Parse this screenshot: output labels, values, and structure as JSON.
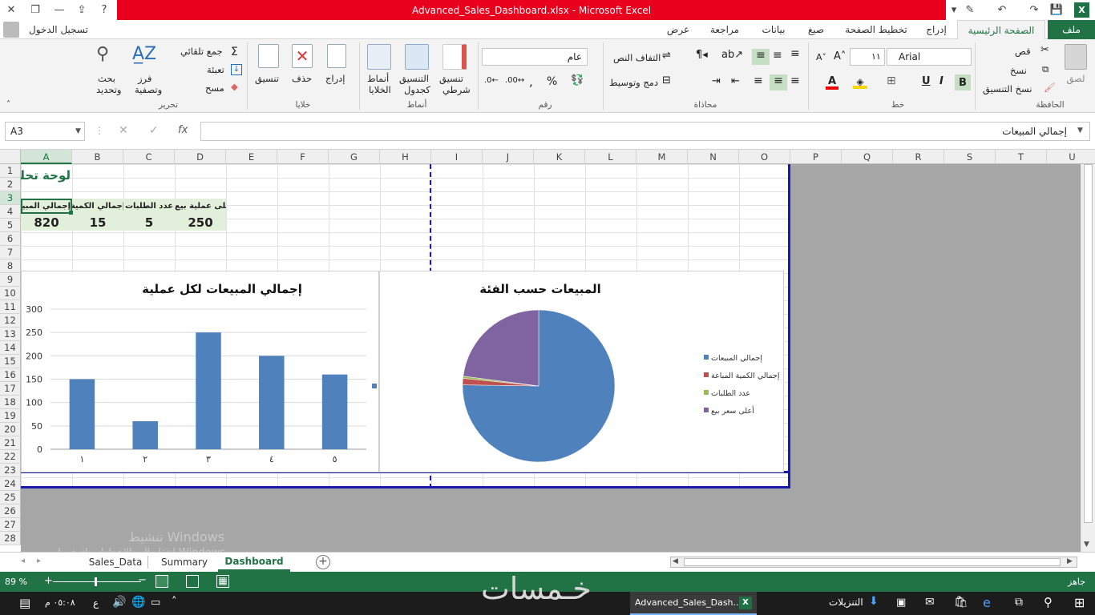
{
  "window": {
    "title": "Advanced_Sales_Dashboard.xlsx -  Microsoft Excel",
    "sign_in": "تسجيل الدخول"
  },
  "tabs": [
    "ملف",
    "الصفحة الرئيسية",
    "إدراج",
    "تخطيط الصفحة",
    "صيغ",
    "بيانات",
    "مراجعة",
    "عرض"
  ],
  "ribbon": {
    "clipboard": {
      "label": "الحافظة",
      "paste": "لصق",
      "cut": "قص",
      "copy": "نسخ",
      "format_painter": "نسخ التنسيق"
    },
    "font": {
      "label": "خط",
      "name": "Arial",
      "size": "١١"
    },
    "alignment": {
      "label": "محاذاة",
      "wrap": "التفاف النص",
      "merge": "دمج وتوسيط"
    },
    "number": {
      "label": "رقم",
      "format": "عام"
    },
    "styles": {
      "label": "أنماط",
      "conditional": "تنسيق",
      "conditional2": "شرطي",
      "table": "التنسيق",
      "table2": "كجدول",
      "cell_styles": "أنماط",
      "cell_styles2": "الخلايا"
    },
    "cells": {
      "label": "خلايا",
      "insert": "إدراج",
      "delete": "حذف",
      "format": "تنسيق"
    },
    "editing": {
      "label": "تحرير",
      "autosum": "جمع تلقائي",
      "fill": "تعبئة",
      "clear": "مسح",
      "sort": "فرز",
      "sort2": "وتصفية",
      "find": "بحث",
      "find2": "وتحديد"
    }
  },
  "formula_bar": {
    "name_box": "A3",
    "fx": "fx",
    "content": "إجمالي المبيعات"
  },
  "columns": [
    "A",
    "B",
    "C",
    "D",
    "E",
    "F",
    "G",
    "H",
    "I",
    "J",
    "K",
    "L",
    "M",
    "N",
    "O",
    "P",
    "Q",
    "R",
    "S",
    "T",
    "U"
  ],
  "rows": [
    "1",
    "2",
    "3",
    "4",
    "5",
    "6",
    "7",
    "8",
    "9",
    "10",
    "11",
    "12",
    "13",
    "14",
    "15",
    "16",
    "17",
    "18",
    "19",
    "20",
    "21",
    "22",
    "23",
    "24",
    "25",
    "26",
    "27",
    "28"
  ],
  "sheet": {
    "a1_title": "لوحة تحك",
    "headers": [
      "إجمالي المبيعات",
      "إجمالي الكمية",
      "عدد الطلبات",
      "أعلى عملية بيع"
    ],
    "values": [
      "820",
      "15",
      "5",
      "250"
    ]
  },
  "chart_data": [
    {
      "type": "bar",
      "title": "إجمالي المبيعات لكل عملية",
      "categories": [
        "١",
        "٢",
        "٣",
        "٤",
        "٥"
      ],
      "values": [
        150,
        60,
        250,
        200,
        160
      ],
      "ylim": [
        0,
        300
      ],
      "yticks": [
        "0",
        "50",
        "100",
        "150",
        "200",
        "250",
        "300"
      ],
      "color": "#4f81bd",
      "grid": true,
      "legend": "none"
    },
    {
      "type": "pie",
      "title": "المبيعات حسب الفئة",
      "labels": [
        "إجمالي المبيعات",
        "إجمالي الكمية المباعة",
        "عدد الطلبات",
        "أعلى سعر بيع"
      ],
      "values": [
        820,
        15,
        5,
        250
      ],
      "colors": [
        "#4f81bd",
        "#c0504d",
        "#9bbb59",
        "#8064a2"
      ],
      "legend": "right"
    }
  ],
  "sheet_tabs": [
    "Sales_Data",
    "Summary",
    "Dashboard"
  ],
  "active_sheet": "Dashboard",
  "status": {
    "ready": "جاهز",
    "zoom": "89 %"
  },
  "watermark": {
    "line1": "تنشيط Windows",
    "line2": "انتقل إلى الإعدادات لتنشيط Windows."
  },
  "taskbar": {
    "time": "٠٥:٠٨ م",
    "lang": "ع",
    "downloads": "التنزيلات",
    "excel_task": "Advanced_Sales_Dash..."
  }
}
